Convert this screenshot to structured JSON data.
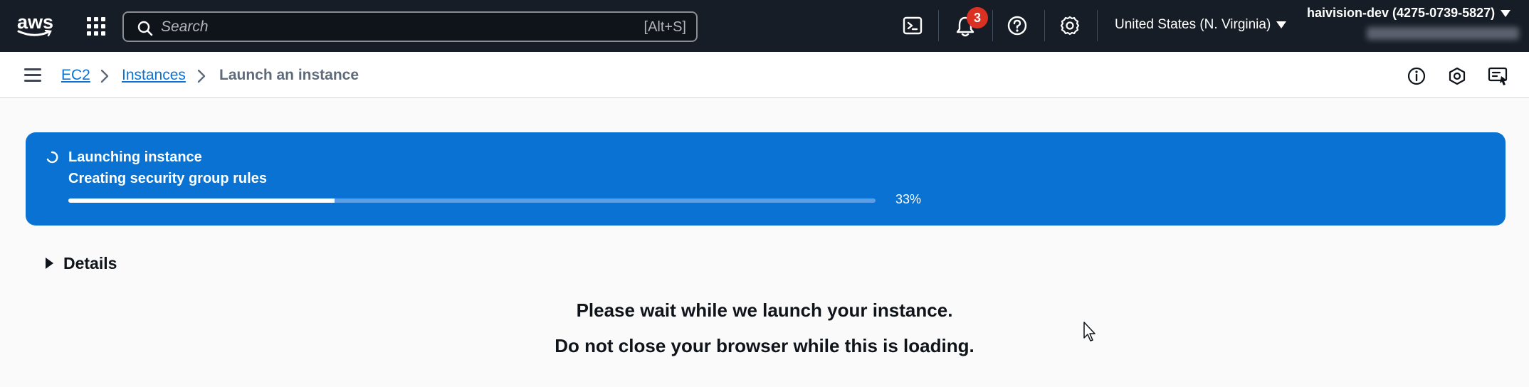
{
  "topnav": {
    "logo_text": "aws",
    "search": {
      "placeholder": "Search",
      "shortcut": "[Alt+S]"
    },
    "notifications_count": "3",
    "region": "United States (N. Virginia)",
    "account": "haivision-dev (4275-0739-5827)",
    "icons": [
      "apps-grid-icon",
      "cloudshell-icon",
      "bell-icon",
      "help-icon",
      "settings-icon"
    ]
  },
  "breadcrumb": {
    "items": [
      "EC2",
      "Instances"
    ],
    "current": "Launch an instance"
  },
  "flash": {
    "title": "Launching instance",
    "subtitle": "Creating security group rules",
    "progress": 0.33,
    "progress_label": "33%",
    "color": "#0972d3"
  },
  "details_label": "Details",
  "message": {
    "line1": "Please wait while we launch your instance.",
    "line2": "Do not close your browser while this is loading."
  }
}
